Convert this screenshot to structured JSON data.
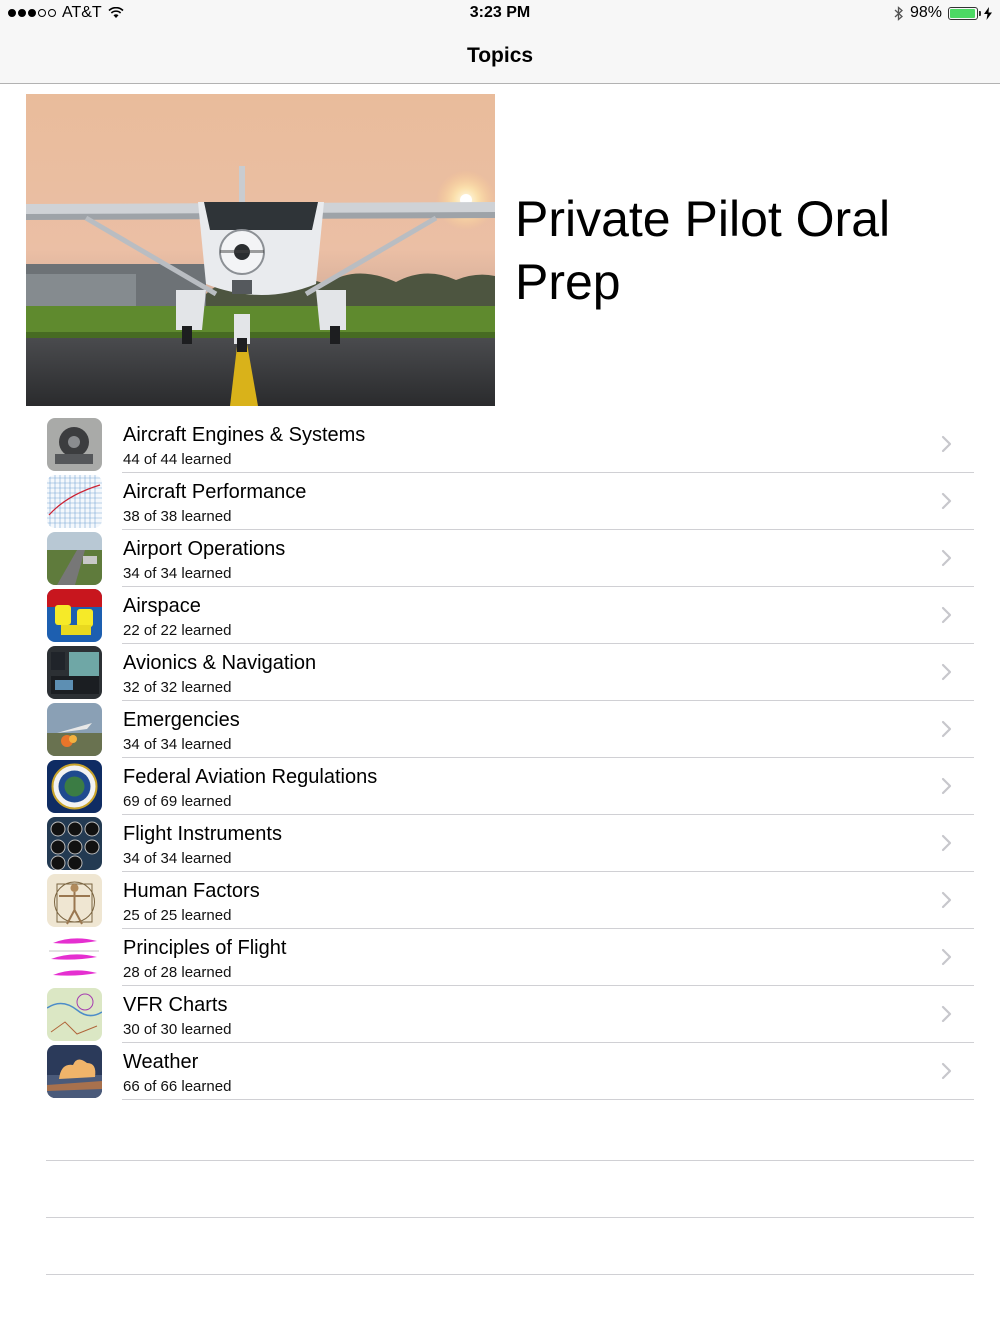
{
  "status_bar": {
    "carrier": "AT&T",
    "time": "3:23 PM",
    "battery_percent": "98%",
    "battery_level": 0.98
  },
  "nav": {
    "title": "Topics"
  },
  "hero": {
    "title": "Private Pilot Oral Prep"
  },
  "topics": [
    {
      "name": "Aircraft Engines & Systems",
      "progress": "44 of 44 learned",
      "icon": "engine-thumbnail"
    },
    {
      "name": "Aircraft Performance",
      "progress": "38 of 38 learned",
      "icon": "performance-chart-thumbnail"
    },
    {
      "name": "Airport Operations",
      "progress": "34 of 34 learned",
      "icon": "airport-thumbnail"
    },
    {
      "name": "Airspace",
      "progress": "22 of 22 learned",
      "icon": "airspace-thumbnail"
    },
    {
      "name": "Avionics & Navigation",
      "progress": "32 of 32 learned",
      "icon": "avionics-thumbnail"
    },
    {
      "name": "Emergencies",
      "progress": "34 of 34 learned",
      "icon": "emergencies-thumbnail"
    },
    {
      "name": "Federal Aviation Regulations",
      "progress": "69 of 69 learned",
      "icon": "faa-seal-thumbnail"
    },
    {
      "name": "Flight Instruments",
      "progress": "34 of 34 learned",
      "icon": "instruments-thumbnail"
    },
    {
      "name": "Human Factors",
      "progress": "25 of 25 learned",
      "icon": "vitruvian-thumbnail"
    },
    {
      "name": "Principles of Flight",
      "progress": "28 of 28 learned",
      "icon": "airfoil-thumbnail"
    },
    {
      "name": "VFR Charts",
      "progress": "30 of 30 learned",
      "icon": "vfr-chart-thumbnail"
    },
    {
      "name": "Weather",
      "progress": "66 of 66 learned",
      "icon": "weather-thumbnail"
    }
  ],
  "colors": {
    "bar_background": "#f7f7f7",
    "separator": "#d0d0d4",
    "chevron": "#c7c7cc",
    "battery_fill": "#4cd964"
  }
}
